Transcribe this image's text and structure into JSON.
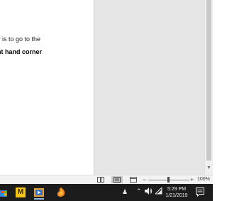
{
  "document": {
    "line1": "y is to go to the",
    "line2": "nt hand corner"
  },
  "statusbar": {
    "zoom_minus": "−",
    "zoom_plus": "+",
    "zoom_level": "100%",
    "zoom_fraction": 0.5
  },
  "taskbar": {
    "app_letter": "M",
    "app_letter_color": "#f5c518",
    "clock_time": "5:29 PM",
    "clock_date": "1/21/2019"
  },
  "icons": {
    "people": "people-icon",
    "chevron": "chevron-up-icon",
    "speaker": "speaker-icon",
    "wifi": "wifi-icon",
    "notifications": "notifications-icon"
  }
}
